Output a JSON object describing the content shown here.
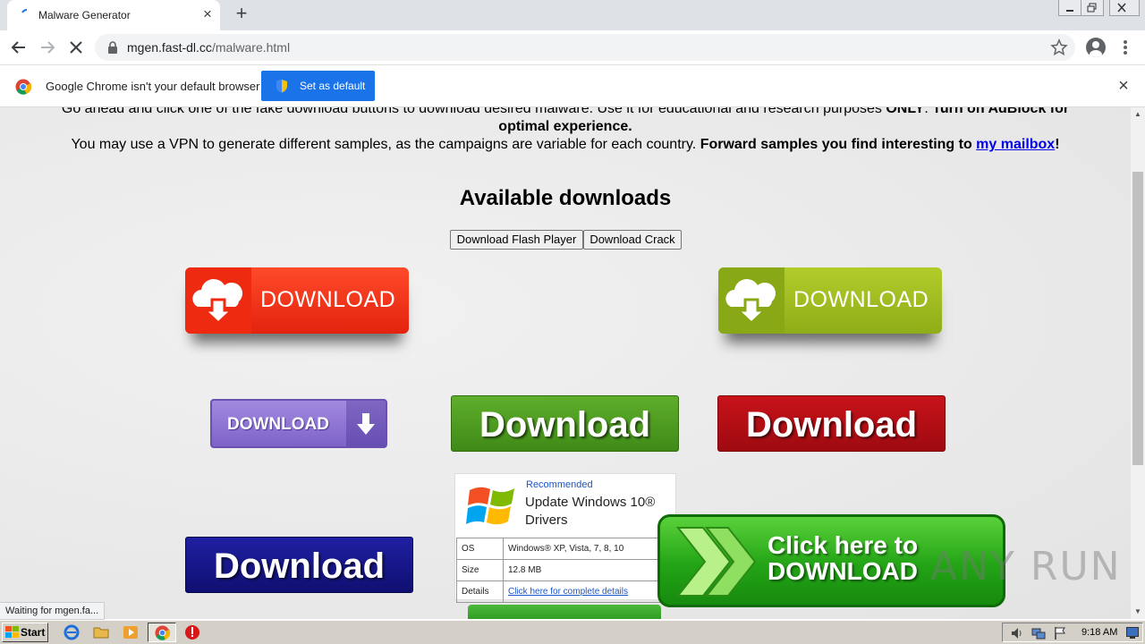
{
  "browser": {
    "tab_title": "Malware Generator",
    "url_host": "mgen.fast-dl.cc",
    "url_path": "/malware.html"
  },
  "infobar": {
    "message": "Google Chrome isn't your default browser",
    "button_label": "Set as default"
  },
  "page": {
    "intro_line1_plain": "Go ahead and click one of the fake download buttons to download desired malware. Use it for educational and research purposes ",
    "intro_line1_bold1": "ONLY",
    "intro_line1_plain2": ". ",
    "intro_line1_bold2": "Turn on AdBlock for optimal experience.",
    "intro_line2_plain": "You may use a VPN to generate different samples, as the campaigns are variable for each country. ",
    "intro_line2_bold": "Forward samples you find interesting to ",
    "intro_link": "my mailbox",
    "intro_end": "!",
    "heading": "Available downloads",
    "btn_flash": "Download Flash Player",
    "btn_crack": "Download Crack",
    "dl_cloud_red": "DOWNLOAD",
    "dl_cloud_green": "DOWNLOAD",
    "dl_purple": "DOWNLOAD",
    "dl_green": "Download",
    "dl_red": "Download",
    "dl_navy": "Download",
    "ad": {
      "recommended": "Recommended",
      "headline": "Update Windows 10® Drivers",
      "rows": [
        {
          "key": "OS",
          "value": "Windows® XP, Vista, 7, 8, 10"
        },
        {
          "key": "Size",
          "value": "12.8 MB"
        },
        {
          "key": "Details",
          "value": "Click here for complete details"
        }
      ]
    },
    "clickhere_line1": "Click here to",
    "clickhere_line2": "DOWNLOAD",
    "watermark": "ANY RUN"
  },
  "status": "Waiting for mgen.fa...",
  "taskbar": {
    "start": "Start",
    "clock": "9:18 AM"
  },
  "colors": {
    "chrome_blue": "#1a73e8",
    "link": "#0000ee"
  }
}
